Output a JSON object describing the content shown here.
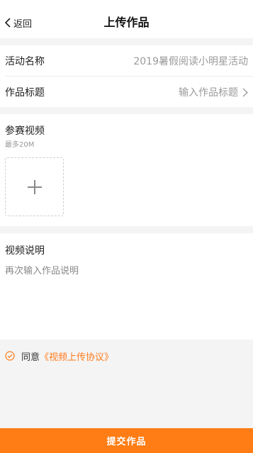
{
  "header": {
    "back_label": "返回",
    "title": "上传作品"
  },
  "form": {
    "activity": {
      "label": "活动名称",
      "value": "2019暑假阅读小明星活动"
    },
    "work_title": {
      "label": "作品标题",
      "placeholder": "输入作品标题"
    }
  },
  "video": {
    "title": "参赛视频",
    "limit": "最多20M",
    "upload_icon": "plus-icon"
  },
  "description": {
    "title": "视频说明",
    "placeholder": "再次输入作品说明"
  },
  "agreement": {
    "prefix": "同意",
    "link": "《视频上传协议》",
    "checked": true,
    "icon": "check-circle-icon"
  },
  "submit_label": "提交作品",
  "colors": {
    "accent": "#ff7d14",
    "link": "#ff7a1a",
    "background": "#f4f4f4"
  }
}
